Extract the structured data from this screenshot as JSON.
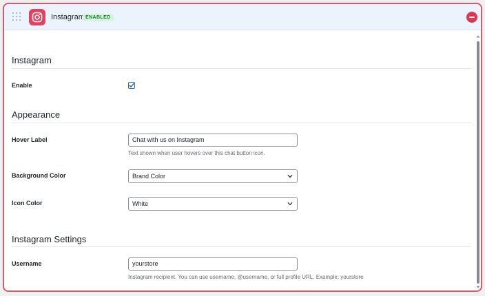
{
  "header": {
    "title": "Instagram",
    "status_badge": "ENABLED",
    "icons": {
      "drag": "drag-handle-icon",
      "brand": "instagram-icon",
      "remove": "remove-icon"
    }
  },
  "sections": {
    "instagram": {
      "title": "Instagram",
      "enable_label": "Enable",
      "enable_checked": true
    },
    "appearance": {
      "title": "Appearance",
      "hover_label": {
        "label": "Hover Label",
        "value": "Chat with us on Instagram",
        "help": "Text shown when user hovers over this chat button icon."
      },
      "background_color": {
        "label": "Background Color",
        "selected": "Brand Color"
      },
      "icon_color": {
        "label": "Icon Color",
        "selected": "White"
      }
    },
    "settings": {
      "title": "Instagram Settings",
      "username": {
        "label": "Username",
        "value": "yourstore",
        "help": "Instagram recipient. You can use username, @username, or full profile URL. Example: yourstore"
      }
    }
  },
  "colors": {
    "accent_border": "#e0566b",
    "instagram_brand": "#e4405f",
    "remove_button": "#e0354e",
    "header_bg": "#ebf3fc",
    "badge_text": "#1a7f37",
    "badge_bg": "#d7f2df",
    "checkbox_accent": "#2271b1"
  }
}
